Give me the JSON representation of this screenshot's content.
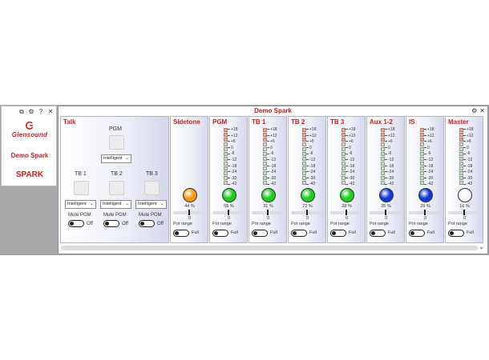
{
  "sidebar": {
    "icons": [
      "copy-icon",
      "gear-icon",
      "help-icon",
      "close-icon"
    ],
    "icon_glyphs": [
      "⧉",
      "⚙",
      "?",
      "✕"
    ],
    "logo_text": "Glensound",
    "device_name": "Demo Spark",
    "model": "SPARK"
  },
  "window": {
    "title": "Demo Spark",
    "btn_glyphs": [
      "⚙",
      "✕"
    ]
  },
  "talk": {
    "title": "Talk",
    "pgm_label": "PGM",
    "pgm_mode": "Intelligent",
    "tb_labels": [
      "TB 1",
      "TB 2",
      "TB 3"
    ],
    "tb_modes": [
      "Intelligent",
      "Intelligent",
      "Intelligent"
    ],
    "mute_label": "Mute PGM",
    "toggle_state": "Off"
  },
  "channels": [
    {
      "name": "Sidetone",
      "percent": "44 %",
      "knob_color": "#f39a12",
      "has_meter": false
    },
    {
      "name": "PGM",
      "percent": "55 %",
      "knob_color": "#1fcc1f",
      "has_meter": true
    },
    {
      "name": "TB 1",
      "percent": "31 %",
      "knob_color": "#1fcc1f",
      "has_meter": true
    },
    {
      "name": "TB 2",
      "percent": "72 %",
      "knob_color": "#1fcc1f",
      "has_meter": true
    },
    {
      "name": "TB 3",
      "percent": "28 %",
      "knob_color": "#1fcc1f",
      "has_meter": true
    },
    {
      "name": "Aux 1-2",
      "percent": "35 %",
      "knob_color": "#1238d8",
      "has_meter": true
    },
    {
      "name": "IS",
      "percent": "29 %",
      "knob_color": "#1238d8",
      "has_meter": true
    },
    {
      "name": "Master",
      "percent": "16 %",
      "knob_color": "#f4f4f4",
      "has_meter": true
    }
  ],
  "channel_common": {
    "slider_value": "0",
    "pot_range_label": "Pot range",
    "pot_range_state": "Full"
  },
  "meter_scale": [
    "+18",
    "+12",
    "+6",
    "0",
    "-6",
    "-12",
    "-18",
    "-24",
    "-30",
    "-42"
  ],
  "scrollbar": {
    "chevron": "⌄"
  }
}
